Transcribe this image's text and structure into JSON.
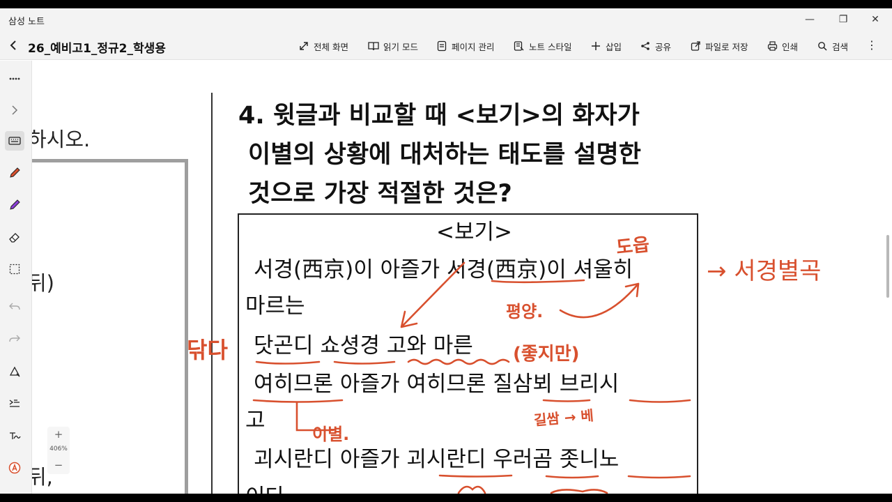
{
  "window": {
    "app_title": "삼성 노트",
    "minimize": "—",
    "maximize": "❐",
    "close": "✕"
  },
  "toolbar": {
    "back": "<",
    "doc_title": "26_예비고1_정규2_학생용",
    "items": [
      {
        "label": "전체 화면",
        "icon": "fullscreen-icon"
      },
      {
        "label": "읽기 모드",
        "icon": "book-icon"
      },
      {
        "label": "페이지 관리",
        "icon": "page-icon"
      },
      {
        "label": "노트 스타일",
        "icon": "style-icon"
      },
      {
        "label": "삽입",
        "icon": "plus-icon"
      },
      {
        "label": "공유",
        "icon": "share-icon"
      },
      {
        "label": "파일로 저장",
        "icon": "export-icon"
      },
      {
        "label": "인쇄",
        "icon": "print-icon"
      },
      {
        "label": "검색",
        "icon": "search-icon"
      }
    ],
    "more": "⋮"
  },
  "sidebar": {
    "tools": [
      "grid-icon",
      "chevron-right-icon",
      "keyboard-icon",
      "pen-icon",
      "highlighter-icon",
      "eraser-icon",
      "lasso-icon",
      "undo-icon",
      "redo-icon",
      "shape-icon",
      "text-align-icon",
      "handwriting-icon",
      "ai-icon"
    ]
  },
  "zoom": {
    "plus": "+",
    "level": "406%",
    "minus": "−"
  },
  "left_page": {
    "line1": "하시오.",
    "line2": "뒤)",
    "line3": "뒤,"
  },
  "question": {
    "line1": "4. 윗글과  비교할  때  <보기>의  화자가",
    "line2": "이별의  상황에  대처하는  태도를  설명한",
    "line3": "것으로  가장  적절한  것은?"
  },
  "bogi": {
    "heading": "<보기>",
    "lines": [
      "서경(西京)이  아즐가  서경(西京)이  셔울히",
      "마르는",
      "닷곤디  쇼셩경  고와  마른",
      "여히므론  아즐가  여히므론  질삼뵈  브리시",
      "고",
      "괴시란디  아즐가  괴시란디  우러곰  좃니노",
      "이다"
    ]
  },
  "annotations": {
    "a1": "도읍",
    "a2": "평양.",
    "a3": "→ 서경별곡",
    "a4": "닦다",
    "a5": "(좋지만)",
    "a6": "이별.",
    "a7": "길쌈 → 베",
    "color": "#d8502e"
  }
}
